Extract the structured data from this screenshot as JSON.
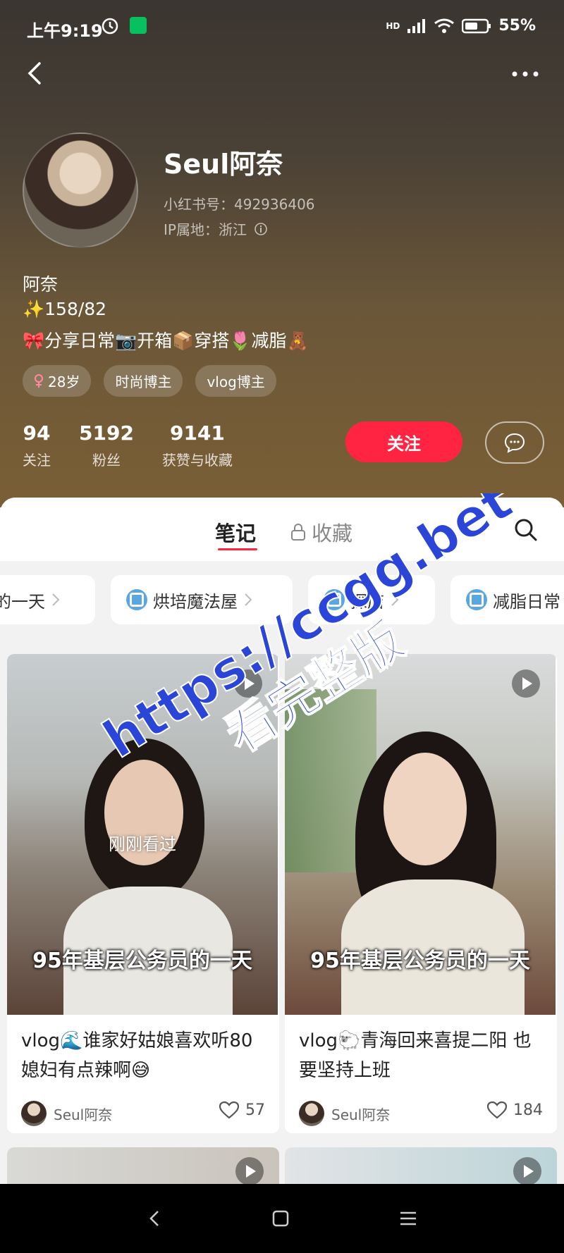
{
  "status_bar": {
    "time": "上午9:19",
    "battery": "55%",
    "network": "HD"
  },
  "profile": {
    "name": "Seul阿奈",
    "xhs_id": "小红书号：492936406",
    "ip": "IP属地：浙江",
    "bio_line1": "阿奈",
    "bio_line2": "✨158/82",
    "bio_line3": "🎀分享日常📷开箱📦穿搭🌷减脂🧸",
    "tags": [
      "28岁",
      "时尚博主",
      "vlog博主"
    ],
    "stats": [
      {
        "value": "94",
        "label": "关注"
      },
      {
        "value": "5192",
        "label": "粉丝"
      },
      {
        "value": "9141",
        "label": "获赞与收藏"
      }
    ],
    "follow_label": "关注"
  },
  "tabs": {
    "notes": "笔记",
    "favorites": "收藏"
  },
  "collections": [
    "的一天",
    "烘培魔法屋",
    "探店",
    "减脂日常"
  ],
  "cards": [
    {
      "caption": "95年基层公务员的一天",
      "overlay": "刚刚看过",
      "title": "vlog🌊谁家好姑娘喜欢听80媳妇有点辣啊😅",
      "author": "Seul阿奈",
      "likes": "57"
    },
    {
      "caption": "95年基层公务员的一天",
      "title": "vlog🐑青海回来喜提二阳 也要坚持上班",
      "author": "Seul阿奈",
      "likes": "184"
    }
  ],
  "watermark": {
    "line1": "https://ccgg.bet",
    "line2": "看完整版",
    "color": "#2a45d8"
  },
  "colors": {
    "accent": "#ff2442"
  }
}
